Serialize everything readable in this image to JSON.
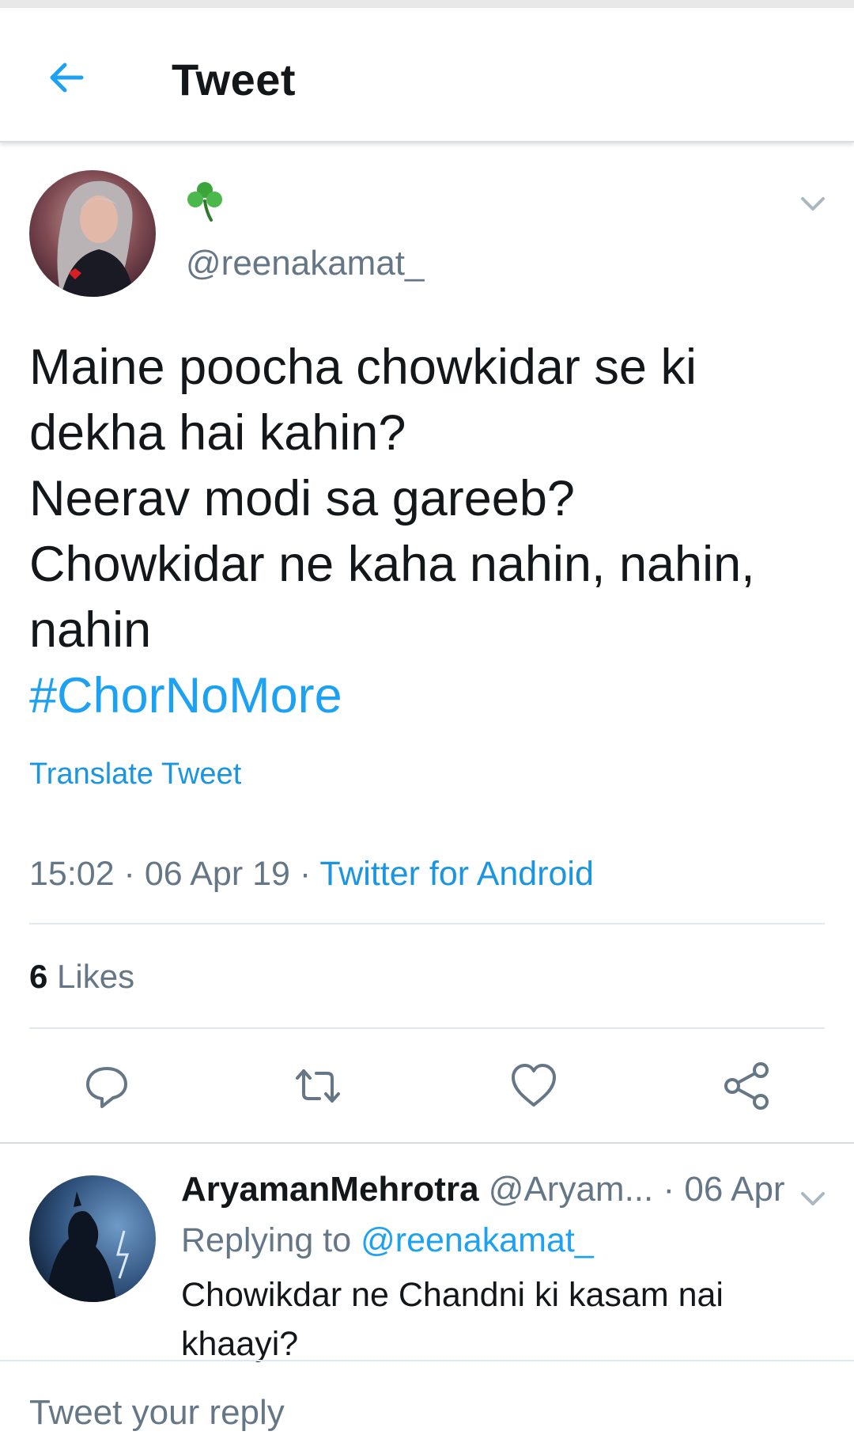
{
  "header": {
    "title": "Tweet",
    "back_icon": "arrow-left-icon"
  },
  "tweet": {
    "author_emoji": "☘",
    "handle": "@reenakamat_",
    "text_lines": [
      "Maine poocha chowkidar se ki",
      "dekha hai kahin?",
      "Neerav modi sa gareeb?",
      "Chowkidar ne kaha nahin, nahin,",
      "nahin"
    ],
    "hashtag": "#ChorNoMore",
    "translate_label": "Translate Tweet",
    "time": "15:02",
    "date": "06 Apr 19",
    "separator": " · ",
    "source": "Twitter for Android",
    "likes_count": "6",
    "likes_label": "Likes"
  },
  "actions": {
    "reply_icon": "reply-icon",
    "retweet_icon": "retweet-icon",
    "like_icon": "heart-icon",
    "share_icon": "share-icon"
  },
  "reply": {
    "name": "AryamanMehrotra",
    "handle": "@Aryam...",
    "separator": " · ",
    "date": "06 Apr",
    "replying_prefix": "Replying to",
    "replying_to": "@reenakamat_",
    "text_lines": [
      "Chowikdar ne Chandni ki kasam nai",
      "khaayi?"
    ]
  },
  "composer": {
    "placeholder": "Tweet your reply"
  },
  "colors": {
    "accent": "#1da1f2",
    "link": "#1b95e0",
    "muted": "#657786",
    "text": "#14171a",
    "divider": "#e1e8ed"
  }
}
